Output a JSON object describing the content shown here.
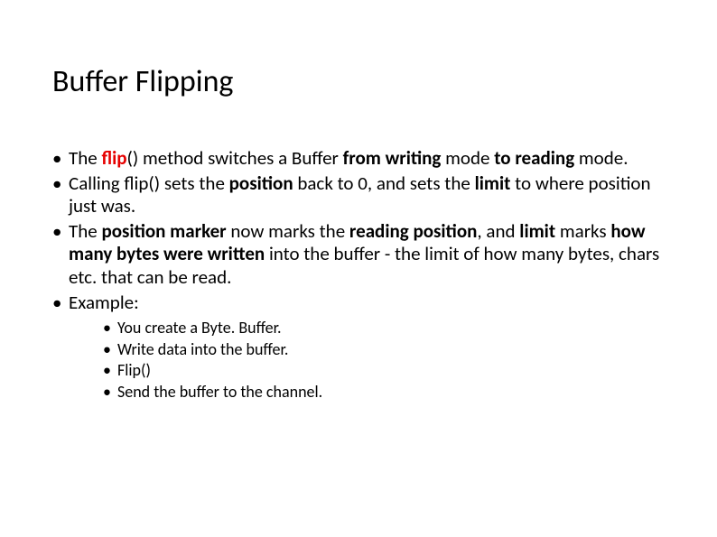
{
  "title": "Buffer Flipping",
  "bullets": [
    {
      "segments": [
        {
          "text": "The "
        },
        {
          "text": "flip",
          "bold": true,
          "red": true
        },
        {
          "text": "() method switches a Buffer "
        },
        {
          "text": "from writing",
          "bold": true
        },
        {
          "text": " mode "
        },
        {
          "text": "to reading",
          "bold": true
        },
        {
          "text": " mode."
        }
      ]
    },
    {
      "segments": [
        {
          "text": "Calling flip() sets the "
        },
        {
          "text": "position",
          "bold": true
        },
        {
          "text": " back to 0, and sets the "
        },
        {
          "text": "limit",
          "bold": true
        },
        {
          "text": " to where position just was."
        }
      ]
    },
    {
      "segments": [
        {
          "text": "The "
        },
        {
          "text": "position marker",
          "bold": true
        },
        {
          "text": " now marks the "
        },
        {
          "text": "reading position",
          "bold": true
        },
        {
          "text": ", and "
        },
        {
          "text": "limit",
          "bold": true
        },
        {
          "text": " marks "
        },
        {
          "text": "how many bytes were written",
          "bold": true
        },
        {
          "text": " into the buffer - the limit of how many bytes, chars etc. that can be read."
        }
      ]
    },
    {
      "segments": [
        {
          "text": "Example:"
        }
      ],
      "sub": [
        "You create a Byte. Buffer.",
        "Write data into the buffer.",
        "Flip()",
        "Send the buffer to the channel."
      ]
    }
  ]
}
